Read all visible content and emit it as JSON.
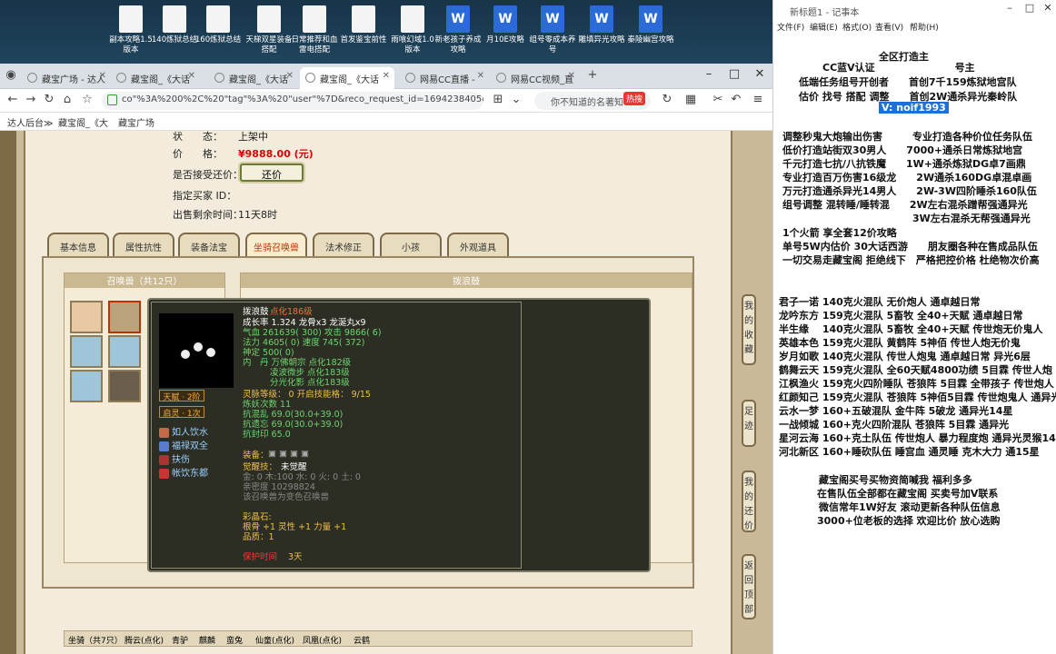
{
  "desktop_icons": [
    {
      "label": "副本攻略1.5版本",
      "type": "doc"
    },
    {
      "label": "140炼狱总结",
      "type": "doc"
    },
    {
      "label": "160炼狱总结",
      "type": "doc"
    },
    {
      "label": "天梯双星装备搭配",
      "type": "doc"
    },
    {
      "label": "日常推荐和血雷电搭配",
      "type": "doc"
    },
    {
      "label": "首发鉴宝前性",
      "type": "doc"
    },
    {
      "label": "雨喰幻域1.0版本",
      "type": "doc"
    },
    {
      "label": "新老孩子养成攻略",
      "type": "word"
    },
    {
      "label": "月10E攻略",
      "type": "word"
    },
    {
      "label": "组号零成本养号",
      "type": "word"
    },
    {
      "label": "雕填异光攻略",
      "type": "word"
    },
    {
      "label": "秦陵幽宫攻略",
      "type": "word"
    }
  ],
  "browser": {
    "tabs": [
      "藏宝广场 - 达人",
      "藏宝阁_《大话",
      "藏宝阁_《大话",
      "藏宝阁_《大话",
      "网易CC直播 - ",
      "网易CC视频_直"
    ],
    "url": "co\"%3A%200%2C%20\"tag\"%3A%20\"user\"%7D&reco_request_id=16942384050665UjJS",
    "search_placeholder": "你不知道的名著知",
    "hot": "热搜",
    "bookmarks": [
      "达人后台≫",
      "藏宝阁_《大",
      "藏宝广场"
    ]
  },
  "item": {
    "status_label": "状　　态：",
    "status_value": "上架中",
    "price_label": "价　　格：",
    "price_value": "¥9888.00 (元)",
    "haggle_label": "是否接受还价：",
    "haggle_btn": "还价",
    "buyer_label": "指定买家 ID：",
    "remain_label": "出售剩余时间：",
    "remain_value": "11天8时"
  },
  "tabs": [
    "基本信息",
    "属性抗性",
    "装备法宝",
    "坐骑召唤兽",
    "法术修正",
    "小孩",
    "外观道具"
  ],
  "pets_header": "召唤兽（共12只）",
  "pet_name_header": "拨浪鼓",
  "tooltip": {
    "name": "拨浪鼓",
    "name_sub": "点化186级",
    "line1": "成长率 1.324 龙骨x3 龙涎丸x9",
    "line2": "气血 261639( 300) 攻击 9866( 6)",
    "line3": "法力 4605( 0) 速度 745( 372)",
    "line4": "神定 500( 0)",
    "line5": "内　丹 万佛朝宗 点化182级",
    "line6": "凌波微步 点化183级",
    "line7": "分光化影 点化183级",
    "line8": "灵脉等级：  0 开启技能格：  9/15",
    "line9": "炼妖次数 11",
    "line10": "抗混乱 69.0(30.0+39.0)",
    "line11": "抗遗忘 69.0(30.0+39.0)",
    "line12": "抗封印 65.0",
    "equip_label": "装备：",
    "awaken_label": "觉醒技：",
    "awaken_value": "未觉醒",
    "line13": "金: 0 木:100 水: 0 火: 0 土: 0",
    "line14": "亲密度 10298824",
    "line15": "该召唤兽为变色召唤兽",
    "line16": "彩晶石:",
    "line17": "根骨 +1 灵性 +1 力量 +1",
    "line18": "品质：1",
    "line19": "保护时间",
    "line19b": "3天",
    "badge1": "天赋 · 2阶",
    "badge2": "启灵 · 1次",
    "skills": [
      "如人饮水",
      "福禄双全",
      "扶伤",
      "帐饮东都"
    ]
  },
  "right_buttons": [
    "我的收藏",
    "足迹",
    "我的还价",
    "返回顶部"
  ],
  "bottom_tabs": [
    "坐骑（共7只）",
    "腾云(点化)",
    "青驴",
    "麒麟",
    "蛮兔",
    "仙童(点化)",
    "凤凰(点化)",
    "云鹤"
  ],
  "notepad": {
    "title": "新标题1 - 记事本",
    "menu": [
      "文件(F)",
      "编辑(E)",
      "格式(O)",
      "查看(V)",
      "帮助(H)"
    ],
    "lines": [
      "全区打造主",
      "CC蓝V认证　　　　　　　　号主",
      "低端任务组号开创者　　首创7千159炼狱地宫队",
      "估价 找号 搭配 调整　　首创2W通杀异光秦岭队",
      "调整秒鬼大炮输出伤害　　　专业打造各种价位任务队伍",
      "低价打造站街双30男人　　7000+通杀日常炼狱地宫",
      "千元打造七抗/八抗铁魔　　1W+通杀炼狱DG卓7画鼎",
      "专业打造百万伤害16级龙　　2W通杀160DG卓混卓画",
      "万元打造通杀异光14男人　　2W-3W四阶睡杀160队伍",
      "组号调整 混转睡/睡转混　　2W左右混杀蹭帮强通异光",
      "　　　　　　　　　　　　　3W左右混杀无帮强通异光",
      "1个火箭 享全套12价攻略",
      "单号5W内估价 30大话西游　　朋友圈各种在售成品队伍",
      "一切交易走藏宝阁 拒绝线下　严格把控价格 杜绝物次价高",
      "君子一诺 140克火混队 无价炮人 通卓越日常",
      "龙吟东方 159克火混队 5畜牧 全40+天赋 通卓越日常",
      "半生缘　 140克火混队 5畜牧 全40+天赋 传世炮无价鬼人",
      "英雄本色 159克火混队 黄鹤阵 5神佰 传世人炮无价鬼",
      "岁月如歌 140克火混队 传世人炮鬼 通卓越日常 异光6层",
      "鹤舞云天 159克火混队 全60天赋4800功绩 5目霖 传世人炮",
      "江枫渔火 159克火四阶睡队 苍狼阵 5目霖 全带孩子 传世炮人",
      "红颜知己 159克火混队 苍狼阵 5神佰5目霖 传世炮鬼人 通异光",
      "云水一梦 160+五破混队 金牛阵 5破龙 通异光14星",
      "一战倾城 160+克火四阶混队 苍狼阵 5目霖 通异光",
      "星河云海 160+克土队伍 传世炮人 暴力程度炮 通异光灵猴14",
      "河北新区 160+睡砍队伍 睡宫血 通灵睡 克木大力 通15星",
      "藏宝阁买号买物资简喊我 福利多多",
      "在售队伍全部都在藏宝阁 买卖号加V联系",
      "微信常年1W好友 滚动更新各种队伍信息",
      "3000+位老板的选择 欢迎比价 放心选购"
    ],
    "v_line": "V:  noif1993"
  }
}
